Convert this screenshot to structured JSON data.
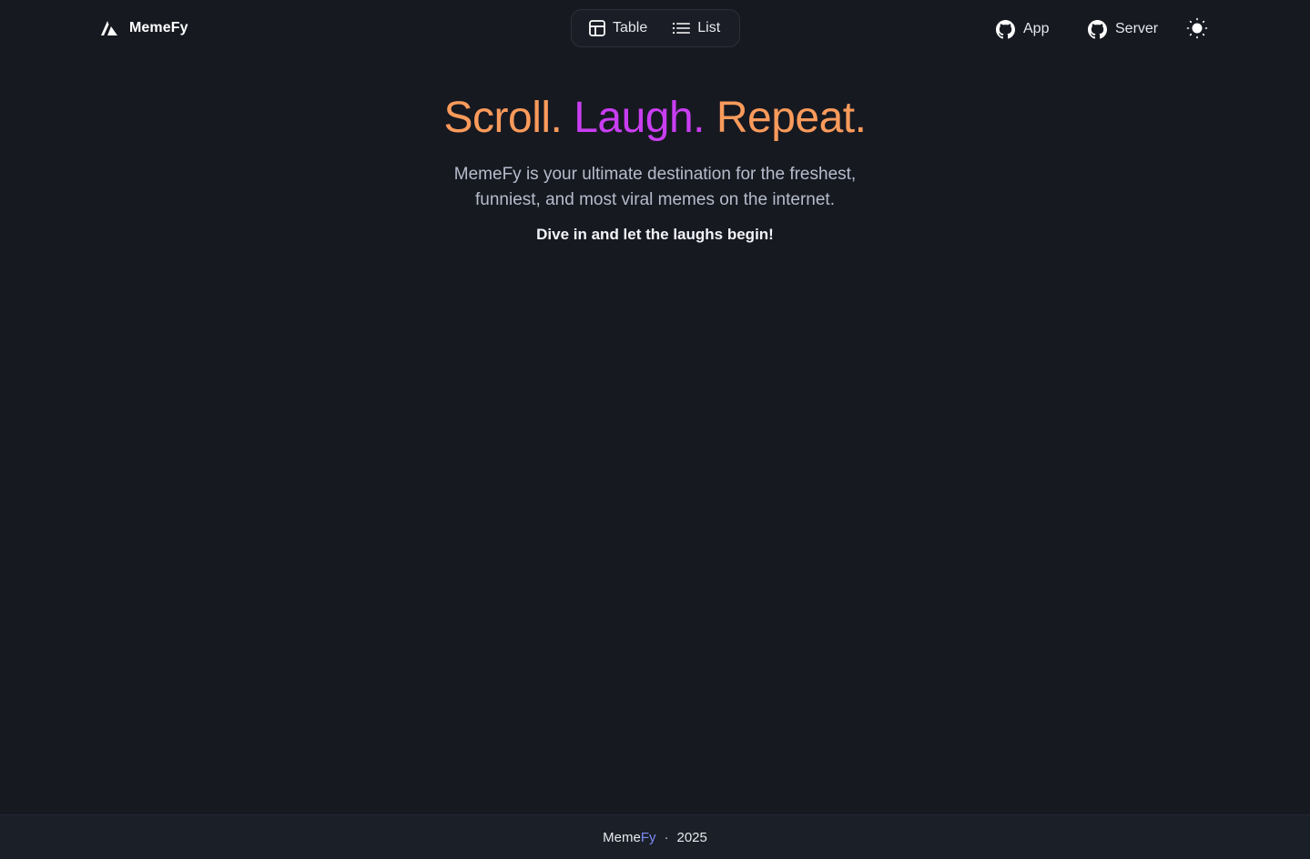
{
  "header": {
    "brand": "MemeFy",
    "view_toggle": {
      "table_label": "Table",
      "list_label": "List"
    },
    "links": [
      {
        "label": "App",
        "icon": "github-icon"
      },
      {
        "label": "Server",
        "icon": "github-icon"
      }
    ],
    "theme_icon": "sun-icon"
  },
  "hero": {
    "headline_part1": "Scroll.",
    "headline_part2": "Laugh.",
    "headline_part3": "Repeat.",
    "tagline": "MemeFy is your ultimate destination for the freshest, funniest, and most viral memes on the internet.",
    "cta": "Dive in and let the laughs begin!"
  },
  "footer": {
    "brand_part1": "Meme",
    "brand_part2": "Fy",
    "separator": "·",
    "year": "2025"
  },
  "colors": {
    "background": "#171921",
    "accent_orange": "#fb9b5b",
    "accent_purple": "#c93ef2",
    "footer_accent": "#7b8cf7"
  }
}
